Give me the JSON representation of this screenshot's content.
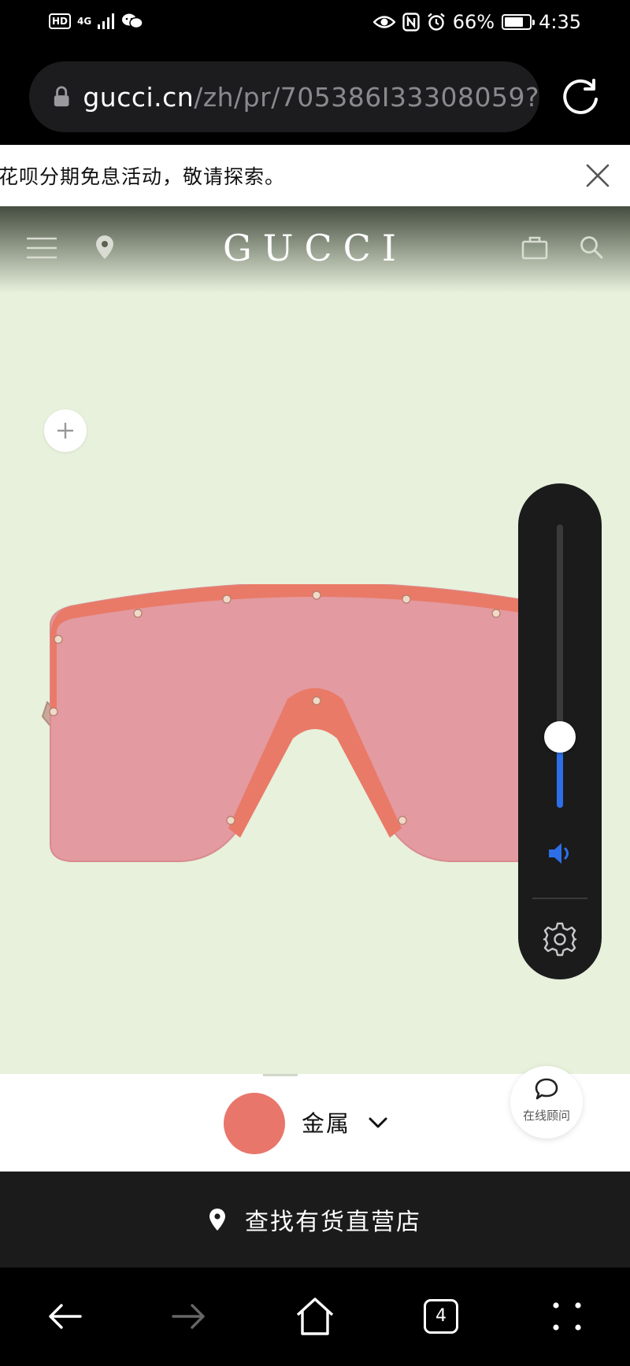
{
  "status_bar": {
    "hd": "HD",
    "network": "4G",
    "battery": "66%",
    "battery_level": 0.66,
    "time": "4:35"
  },
  "browser": {
    "url_domain": "gucci.cn",
    "url_path": "/zh/pr/705386I33308059?",
    "tab_count": "4"
  },
  "notice": {
    "text": "花呗分期免息活动，敬请探索。"
  },
  "header": {
    "logo": "GUCCI"
  },
  "volume": {
    "level": 0.25
  },
  "variant": {
    "swatch_color": "#e8766a",
    "material": "金属"
  },
  "chat": {
    "label": "在线顾问"
  },
  "store": {
    "label": "查找有货直营店"
  },
  "colors": {
    "accent_blue": "#2d6fe8",
    "background": "#e7f1dc",
    "lens": "#e39aa0",
    "frame": "#e97a68"
  }
}
